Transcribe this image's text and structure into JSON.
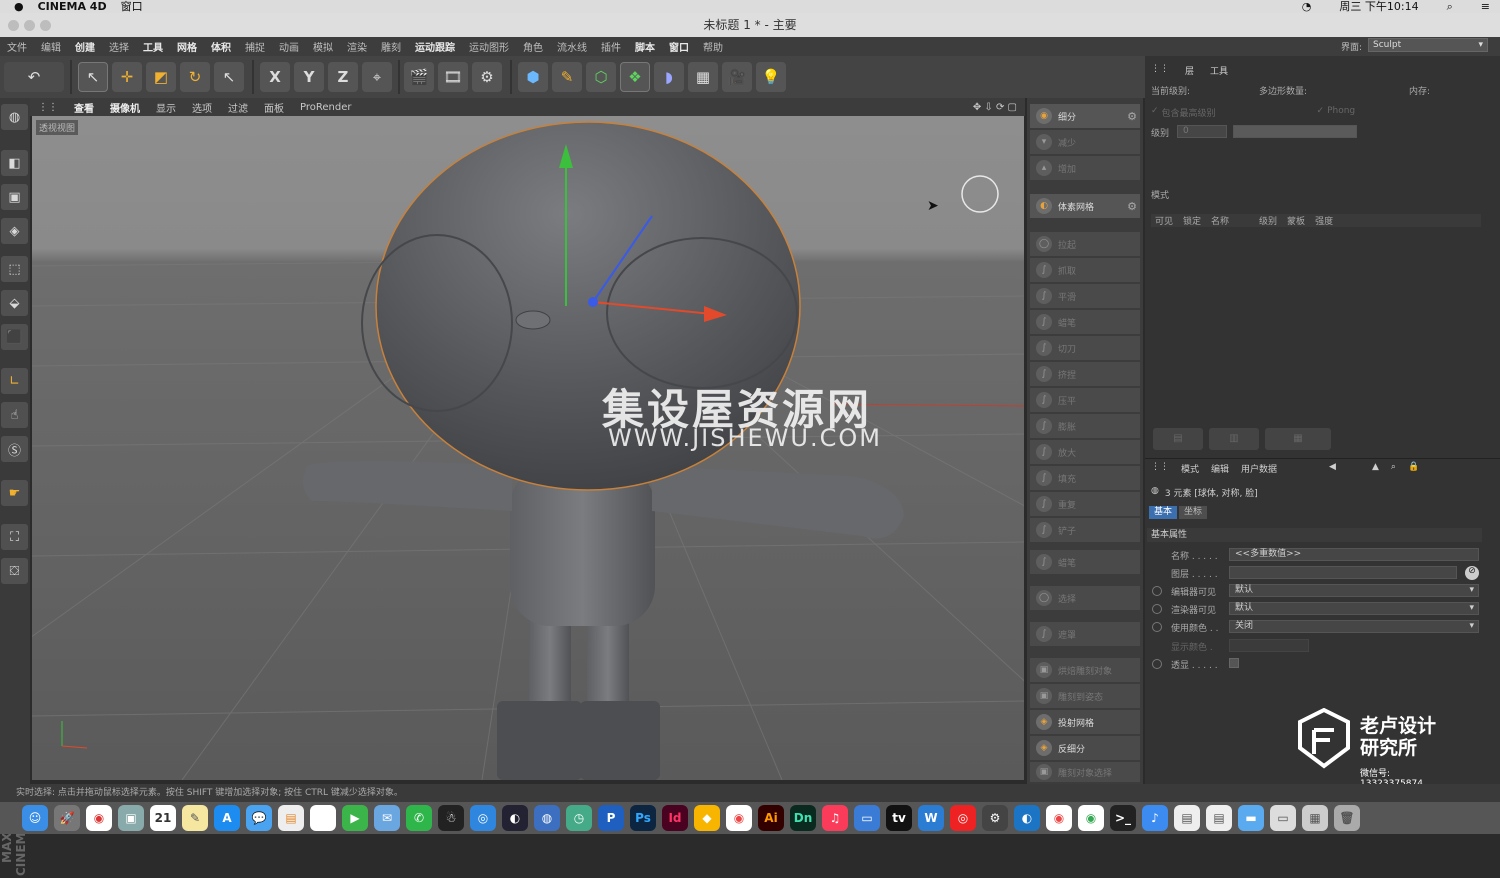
{
  "mac_menubar": {
    "app": "CINEMA 4D",
    "window_menu": "窗口",
    "clock": "周三 下午10:14"
  },
  "window": {
    "title": "未标题 1 * - 主要"
  },
  "menu": {
    "items": [
      "文件",
      "编辑",
      "创建",
      "选择",
      "工具",
      "网格",
      "体积",
      "捕捉",
      "动画",
      "模拟",
      "渲染",
      "雕刻",
      "运动跟踪",
      "运动图形",
      "角色",
      "流水线",
      "插件",
      "脚本",
      "窗口",
      "帮助"
    ],
    "layout_label": "界面:",
    "layout_value": "Sculpt"
  },
  "toolbar": {
    "icons": [
      "undo-icon",
      "live-select-icon",
      "move-icon",
      "scale-icon",
      "rotate-icon",
      "select-icon",
      "x-axis-icon",
      "y-axis-icon",
      "z-axis-icon",
      "coord-icon",
      "render-view-icon",
      "render-picture-icon",
      "render-settings-icon",
      "cube-icon",
      "pen-icon",
      "subdivision-icon",
      "array-icon",
      "deformer-icon",
      "floor-icon",
      "camera-icon",
      "light-icon"
    ],
    "x": "X",
    "y": "Y",
    "z": "Z"
  },
  "viewport": {
    "menu": [
      "查看",
      "摄像机",
      "显示",
      "选项",
      "过滤",
      "面板",
      "ProRender"
    ],
    "label": "透视视图",
    "watermark_cn": "集设屋资源网",
    "watermark_url": "WWW.JISHEWU.COM"
  },
  "left_brand": "MAXON CINEMA 4D",
  "sculpt_panel": {
    "items": [
      {
        "label": "细分",
        "active": true
      },
      {
        "label": "减少",
        "active": false
      },
      {
        "label": "增加",
        "active": false
      },
      {
        "label": "体素网格",
        "active": true
      },
      {
        "label": "拉起",
        "active": false
      },
      {
        "label": "抓取",
        "active": false
      },
      {
        "label": "平滑",
        "active": false
      },
      {
        "label": "蜡笔",
        "active": false
      },
      {
        "label": "切刀",
        "active": false
      },
      {
        "label": "挤捏",
        "active": false
      },
      {
        "label": "压平",
        "active": false
      },
      {
        "label": "膨胀",
        "active": false
      },
      {
        "label": "放大",
        "active": false
      },
      {
        "label": "填充",
        "active": false
      },
      {
        "label": "重复",
        "active": false
      },
      {
        "label": "铲子",
        "active": false
      },
      {
        "label": "蜡笔",
        "active": false
      },
      {
        "label": "选择",
        "active": false
      },
      {
        "label": "遮罩",
        "active": false
      },
      {
        "label": "烘焙雕刻对象",
        "active": false
      },
      {
        "label": "雕刻到姿态",
        "active": false
      },
      {
        "label": "投射网格",
        "active": true
      },
      {
        "label": "反细分",
        "active": true
      },
      {
        "label": "雕刻对象选择",
        "active": false
      }
    ]
  },
  "layers_panel": {
    "tabs": [
      "层",
      "工具"
    ],
    "current_level": "当前级别:",
    "poly_count": "多边形数量:",
    "memory": "内存:",
    "check1": "包含最高级别",
    "check2": "Phong",
    "level_label": "级别",
    "level_value": "0",
    "mode_label": "模式",
    "columns": [
      "可见",
      "锁定",
      "名称",
      "级别",
      "蒙板",
      "强度"
    ]
  },
  "attributes": {
    "menu": [
      "模式",
      "编辑",
      "用户数据"
    ],
    "selection": "3 元素 [球体, 对称, 脸]",
    "tabs": [
      "基本",
      "坐标"
    ],
    "section": "基本属性",
    "rows": [
      {
        "label": "名称 . . . . .",
        "value": "<<多重数值>>"
      },
      {
        "label": "图层 . . . . .",
        "value": ""
      },
      {
        "label": "编辑器可见",
        "value": "默认"
      },
      {
        "label": "渲染器可见",
        "value": "默认"
      },
      {
        "label": "使用颜色 . .",
        "value": "关闭"
      },
      {
        "label": "显示颜色 .",
        "value": ""
      },
      {
        "label": "透显 . . . . .",
        "value": ""
      }
    ]
  },
  "logo": {
    "line1": "老卢设计",
    "line2": "研究所",
    "contact": "微信号: 13323375874"
  },
  "status_text": "实时选择: 点击并拖动鼠标选择元素。按住 SHIFT 键增加选择对象; 按住 CTRL 键减少选择对象。",
  "dock": {
    "apps": [
      "finder",
      "launchpad",
      "chrome",
      "preview",
      "calendar",
      "notes",
      "appstore",
      "messages",
      "pages",
      "photos",
      "facetime",
      "mail",
      "wechat",
      "qq",
      "safari",
      "browser",
      "charles",
      "proxy",
      "P",
      "Ps",
      "Id",
      "sketch",
      "chrome2",
      "Ai",
      "Dn",
      "music",
      "keynote",
      "tv",
      "word",
      "netease",
      "vscode",
      "vpn",
      "chrome3",
      "chrome4",
      "terminal",
      "feishu",
      "doc1",
      "doc2",
      "folder",
      "finder2",
      "dock-end",
      "trash"
    ],
    "labels": {
      "calendar": "21",
      "P": "P",
      "Ps": "Ps",
      "Id": "Id",
      "Ai": "Ai",
      "Dn": "Dn"
    }
  },
  "colors": {
    "accent": "#e6a23c",
    "axis_x": "#e24a2b",
    "axis_y": "#3cbf3c",
    "axis_z": "#3a5ae8"
  }
}
